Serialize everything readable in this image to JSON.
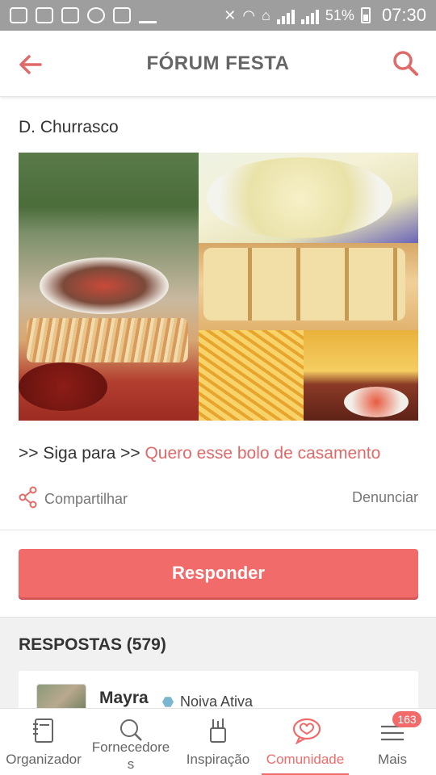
{
  "status_bar": {
    "battery": "51%",
    "time": "07:30",
    "icons": [
      "message-icon",
      "facebook-icon",
      "facebook-icon",
      "whatsapp-icon",
      "image-icon",
      "download-icon",
      "mute-icon",
      "wifi-icon",
      "home-icon",
      "signal-icon",
      "signal-icon",
      "battery-icon"
    ]
  },
  "header": {
    "title": "FÓRUM FESTA",
    "back_icon": "arrow-left-icon",
    "search_icon": "search-icon"
  },
  "post": {
    "title": "D. Churrasco",
    "follow_prefix": ">> Siga para >> ",
    "follow_link": "Quero esse bolo de casamento",
    "share_label": "Compartilhar",
    "report_label": "Denunciar",
    "reply_label": "Responder"
  },
  "responses": {
    "header": "RESPOSTAS (579)",
    "first": {
      "name": "Mayra",
      "badge": "Noiva Ativa"
    }
  },
  "bottom_nav": {
    "items": [
      {
        "label": "Organizador",
        "icon": "notebook-icon"
      },
      {
        "label": "Fornecedore\ns",
        "icon": "search-icon"
      },
      {
        "label": "Inspiração",
        "icon": "pencil-cup-icon"
      },
      {
        "label": "Comunidade",
        "icon": "chat-heart-icon"
      },
      {
        "label": "Mais",
        "icon": "menu-icon"
      }
    ],
    "notification_count": "163",
    "active_index": 3
  },
  "colors": {
    "accent": "#f16b6b",
    "link": "#e06a6a",
    "status_bar": "#9e9e9e"
  }
}
